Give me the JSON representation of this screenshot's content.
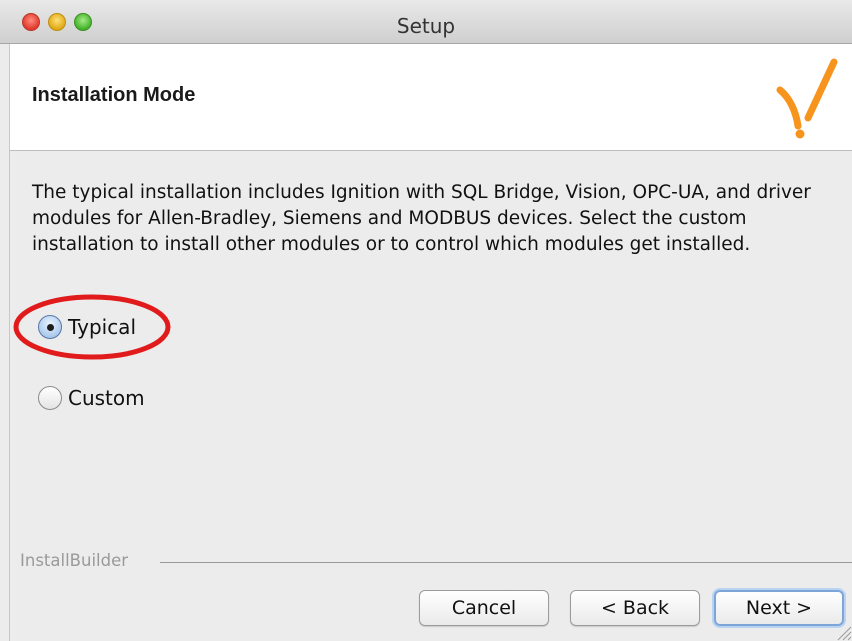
{
  "window": {
    "title": "Setup"
  },
  "header": {
    "title": "Installation Mode",
    "logo_icon": "bitrock-checkmark-logo",
    "logo_color": "#f7941d"
  },
  "content": {
    "description": "The typical installation includes Ignition with SQL Bridge, Vision, OPC-UA, and driver modules for Allen-Bradley, Siemens and MODBUS devices. Select the custom installation to install other modules or to control which modules get installed.",
    "options": [
      {
        "label": "Typical",
        "selected": true
      },
      {
        "label": "Custom",
        "selected": false
      }
    ],
    "highlight_color": "#e11b1b"
  },
  "footer": {
    "builder_label": "InstallBuilder",
    "cancel_label": "Cancel",
    "back_label": "< Back",
    "next_label": "Next >"
  }
}
